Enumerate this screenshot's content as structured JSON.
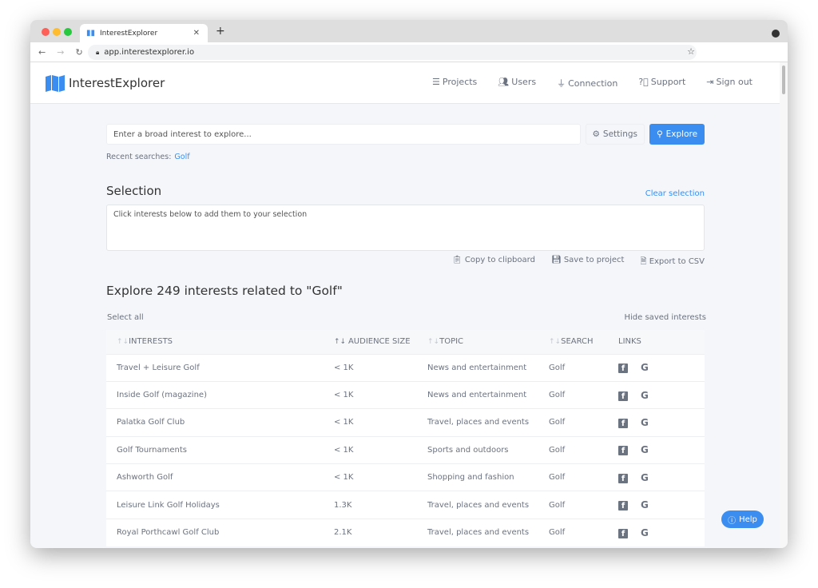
{
  "browser": {
    "tab_title": "InterestExplorer",
    "url": "app.interestexplorer.io"
  },
  "app": {
    "name": "InterestExplorer",
    "nav": [
      {
        "label": "Projects",
        "icon": "list-icon"
      },
      {
        "label": "Users",
        "icon": "users-icon"
      },
      {
        "label": "Connection",
        "icon": "plug-icon"
      },
      {
        "label": "Support",
        "icon": "question-icon"
      },
      {
        "label": "Sign out",
        "icon": "sign-out-icon"
      }
    ]
  },
  "search": {
    "placeholder": "Enter a broad interest to explore...",
    "settings_label": "Settings",
    "explore_label": "Explore",
    "recent_label": "Recent searches:",
    "recent_item": "Golf"
  },
  "selection": {
    "title": "Selection",
    "clear_label": "Clear selection",
    "placeholder": "Click interests below to add them to your selection",
    "copy_label": "Copy to clipboard",
    "save_label": "Save to project",
    "export_label": "Export to CSV"
  },
  "results": {
    "title": "Explore 249 interests related to \"Golf\"",
    "select_all": "Select all",
    "hide_saved": "Hide saved interests",
    "columns": [
      "INTERESTS",
      "AUDIENCE SIZE",
      "TOPIC",
      "SEARCH",
      "LINKS"
    ],
    "rows": [
      {
        "interest": "Travel + Leisure Golf",
        "audience": "< 1K",
        "topic": "News and entertainment",
        "search": "Golf"
      },
      {
        "interest": "Inside Golf (magazine)",
        "audience": "< 1K",
        "topic": "News and entertainment",
        "search": "Golf"
      },
      {
        "interest": "Palatka Golf Club",
        "audience": "< 1K",
        "topic": "Travel, places and events",
        "search": "Golf"
      },
      {
        "interest": "Golf Tournaments",
        "audience": "< 1K",
        "topic": "Sports and outdoors",
        "search": "Golf"
      },
      {
        "interest": "Ashworth Golf",
        "audience": "< 1K",
        "topic": "Shopping and fashion",
        "search": "Golf"
      },
      {
        "interest": "Leisure Link Golf Holidays",
        "audience": "1.3K",
        "topic": "Travel, places and events",
        "search": "Golf"
      },
      {
        "interest": "Royal Porthcawl Golf Club",
        "audience": "2.1K",
        "topic": "Travel, places and events",
        "search": "Golf"
      }
    ]
  },
  "help_label": "Help",
  "colors": {
    "accent": "#3b8ef0",
    "background": "#f4f6f9"
  }
}
